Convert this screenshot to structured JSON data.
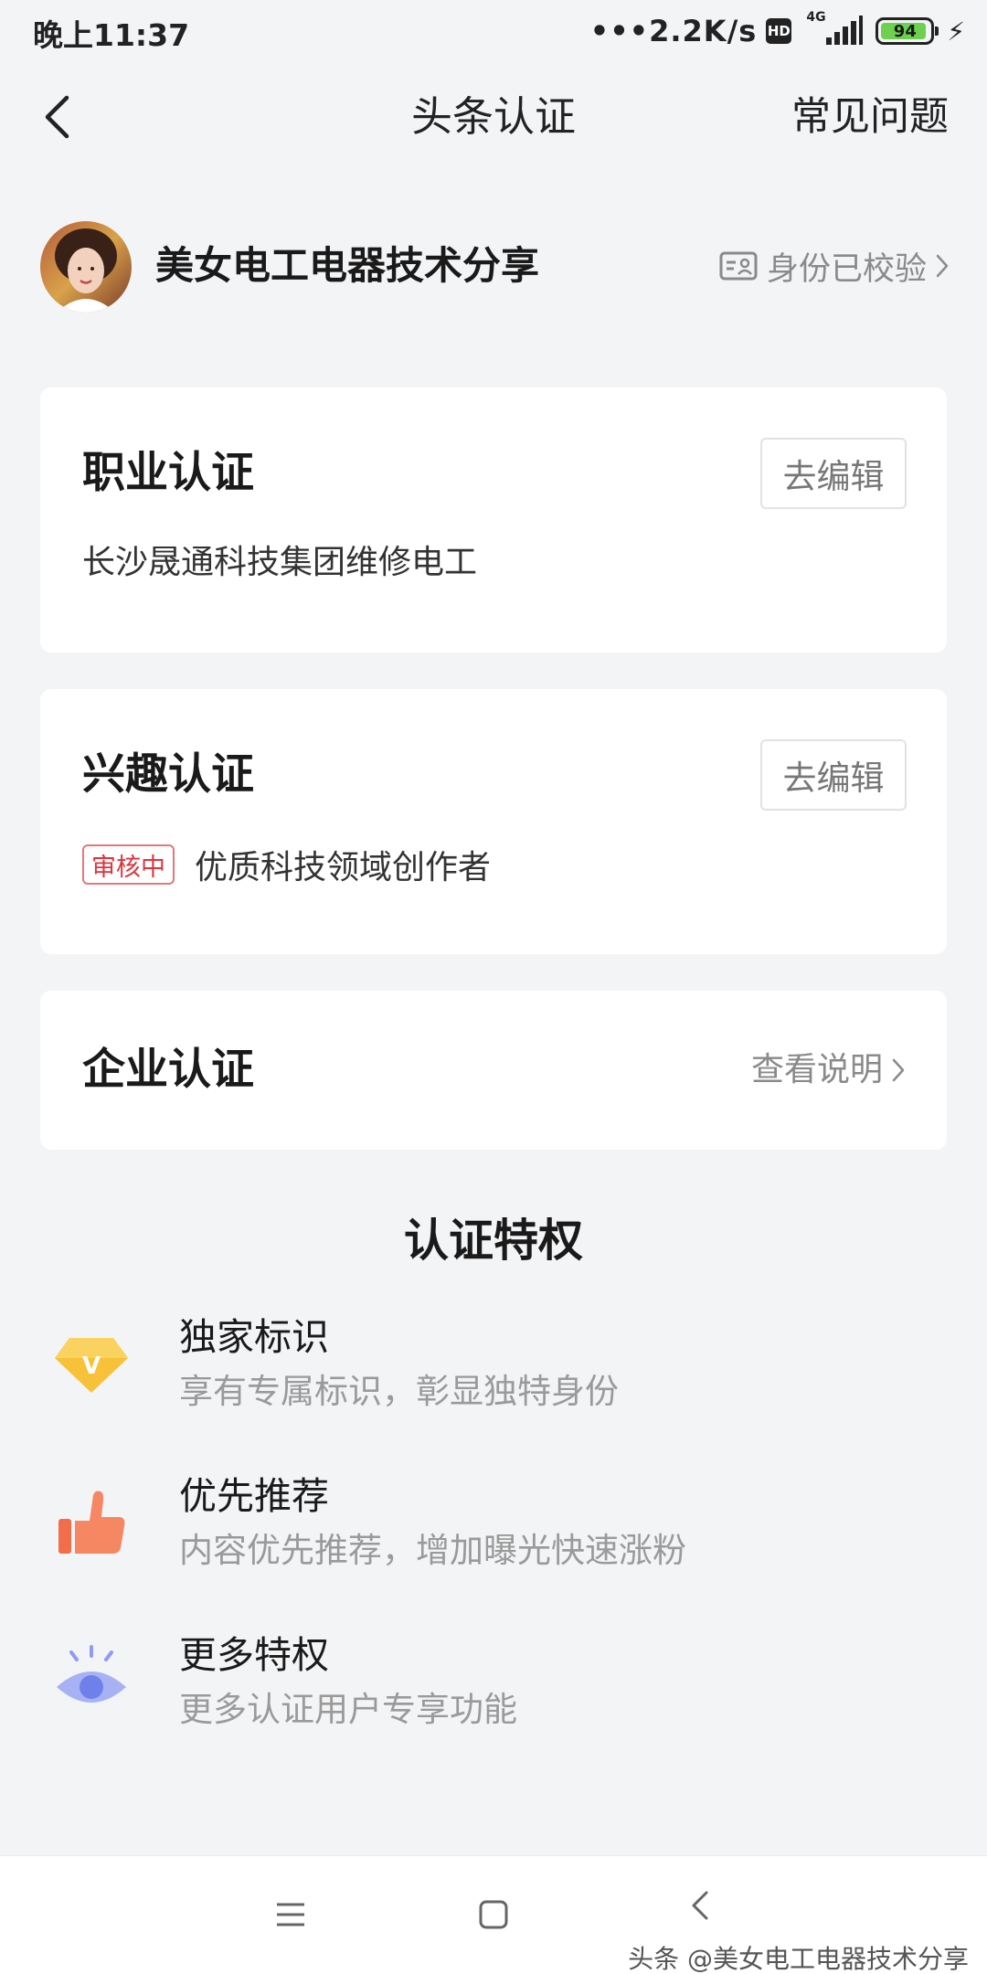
{
  "status_bar": {
    "time": "晚上11:37",
    "net_speed": "•••2.2K/s",
    "hd_label": "HD",
    "network_type": "4G",
    "battery_level": "94"
  },
  "header": {
    "title": "头条认证",
    "faq_label": "常见问题"
  },
  "profile": {
    "name": "美女电工电器技术分享",
    "verify_status": "身份已校验"
  },
  "cards": {
    "profession": {
      "title": "职业认证",
      "edit_label": "去编辑",
      "description": "长沙晟通科技集团维修电工"
    },
    "interest": {
      "title": "兴趣认证",
      "edit_label": "去编辑",
      "badge": "审核中",
      "description": "优质科技领域创作者"
    },
    "enterprise": {
      "title": "企业认证",
      "link_label": "查看说明"
    }
  },
  "privileges": {
    "section_title": "认证特权",
    "items": [
      {
        "title": "独家标识",
        "desc": "享有专属标识，彰显独特身份",
        "icon": "diamond-v-icon"
      },
      {
        "title": "优先推荐",
        "desc": "内容优先推荐，增加曝光快速涨粉",
        "icon": "thumbs-up-icon"
      },
      {
        "title": "更多特权",
        "desc": "更多认证用户专享功能",
        "icon": "eye-icon"
      }
    ]
  },
  "watermark": "头条 @美女电工电器技术分享",
  "colors": {
    "background": "#f3f4f6",
    "review_badge": "#d9363e",
    "diamond": "#f7c23a",
    "thumb": "#f26d4a",
    "eye": "#8f9cf0"
  }
}
